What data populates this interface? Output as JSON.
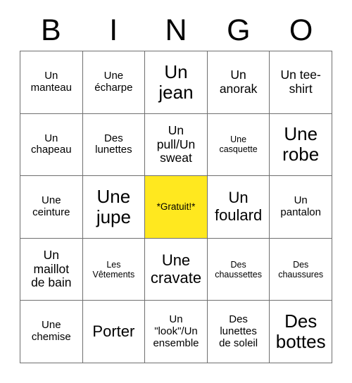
{
  "card": {
    "title": "BINGO",
    "header_letters": [
      "B",
      "I",
      "N",
      "G",
      "O"
    ],
    "free_color": "#FFE81F",
    "grid_line_color": "#6F6F6F",
    "text_color": "#000000",
    "background_color": "#FFFFFF",
    "rows": 5,
    "columns": 5
  },
  "cells": [
    {
      "text": "Un\nmanteau",
      "size": "sm",
      "free": false
    },
    {
      "text": "Une\nécharpe",
      "size": "sm",
      "free": false
    },
    {
      "text": "Un\njean",
      "size": "xl",
      "free": false
    },
    {
      "text": "Un\nanorak",
      "size": "md",
      "free": false
    },
    {
      "text": "Un tee-\nshirt",
      "size": "md",
      "free": false
    },
    {
      "text": "Un\nchapeau",
      "size": "sm",
      "free": false
    },
    {
      "text": "Des\nlunettes",
      "size": "sm",
      "free": false
    },
    {
      "text": "Un\npull/Un\nsweat",
      "size": "md",
      "free": false
    },
    {
      "text": "Une\ncasquette",
      "size": "xs",
      "free": false
    },
    {
      "text": "Une\nrobe",
      "size": "xl",
      "free": false
    },
    {
      "text": "Une\nceinture",
      "size": "sm",
      "free": false
    },
    {
      "text": "Une\njupe",
      "size": "xl",
      "free": false
    },
    {
      "text": "*Gratuit!*",
      "size": "xs",
      "free": true
    },
    {
      "text": "Un\nfoulard",
      "size": "lg",
      "free": false
    },
    {
      "text": "Un\npantalon",
      "size": "sm",
      "free": false
    },
    {
      "text": "Un\nmaillot\nde bain",
      "size": "md",
      "free": false
    },
    {
      "text": "Les\nVêtements",
      "size": "xs",
      "free": false
    },
    {
      "text": "Une\ncravate",
      "size": "lg",
      "free": false
    },
    {
      "text": "Des\nchaussettes",
      "size": "xs",
      "free": false
    },
    {
      "text": "Des\nchaussures",
      "size": "xs",
      "free": false
    },
    {
      "text": "Une\nchemise",
      "size": "sm",
      "free": false
    },
    {
      "text": "Porter",
      "size": "lg",
      "free": false
    },
    {
      "text": "Un\n\"look\"/Un\nensemble",
      "size": "sm",
      "free": false
    },
    {
      "text": "Des\nlunettes\nde soleil",
      "size": "sm",
      "free": false
    },
    {
      "text": "Des\nbottes",
      "size": "xl",
      "free": false
    }
  ]
}
